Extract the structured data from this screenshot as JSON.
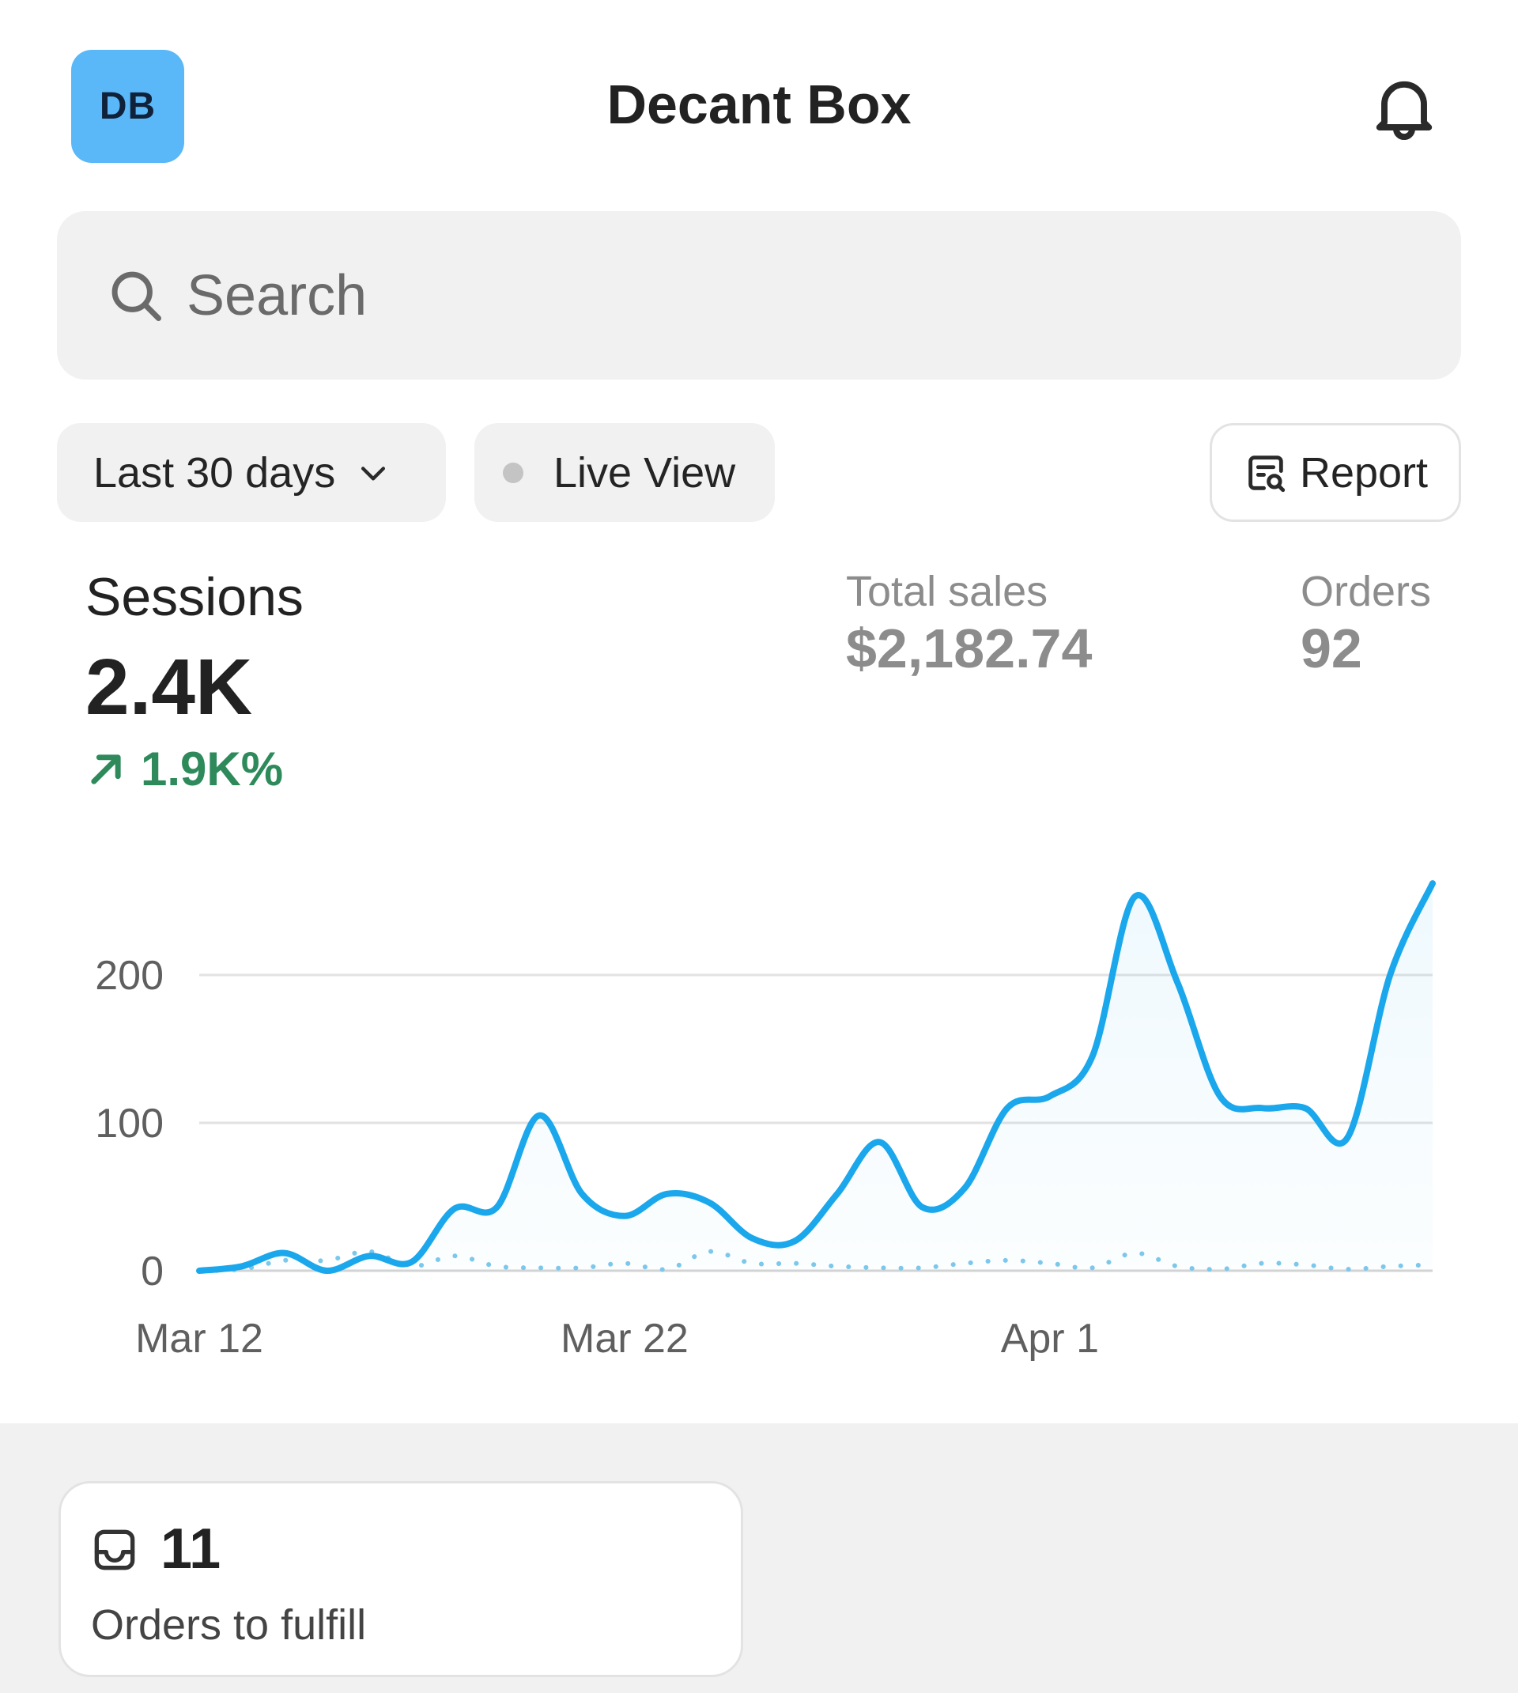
{
  "header": {
    "avatar_initials": "DB",
    "store_name": "Decant Box",
    "notification_icon": "bell-icon"
  },
  "search": {
    "placeholder": "Search",
    "icon": "search-icon"
  },
  "filters": {
    "date_range": "Last 30 days",
    "live_view": "Live View",
    "report": "Report"
  },
  "metrics": {
    "sessions": {
      "label": "Sessions",
      "value": "2.4K",
      "change": "1.9K%",
      "change_color": "#2e8a5b"
    },
    "total_sales": {
      "label": "Total sales",
      "value": "$2,182.74"
    },
    "orders": {
      "label": "Orders",
      "value": "92"
    }
  },
  "chart_data": {
    "type": "line",
    "y_ticks": [
      "200",
      "100",
      "0"
    ],
    "x_tick_labels": [
      "Mar 12",
      "Mar 22",
      "Apr 1"
    ],
    "ylim": [
      0,
      260
    ],
    "grid": true,
    "accent_color": "#1aa7ec",
    "series": [
      {
        "style": "solid",
        "x": [
          "Mar 12",
          "Mar 13",
          "Mar 14",
          "Mar 15",
          "Mar 16",
          "Mar 17",
          "Mar 18",
          "Mar 19",
          "Mar 20",
          "Mar 21",
          "Mar 22",
          "Mar 23",
          "Mar 24",
          "Mar 25",
          "Mar 26",
          "Mar 27",
          "Mar 28",
          "Mar 29",
          "Mar 30",
          "Mar 31",
          "Apr 1",
          "Apr 2",
          "Apr 3",
          "Apr 4",
          "Apr 5",
          "Apr 6",
          "Apr 7",
          "Apr 8",
          "Apr 9",
          "Apr 10"
        ],
        "values": [
          0,
          3,
          12,
          0,
          10,
          6,
          42,
          43,
          105,
          52,
          37,
          52,
          46,
          22,
          20,
          52,
          87,
          43,
          56,
          110,
          118,
          145,
          253,
          195,
          118,
          110,
          110,
          90,
          200,
          262
        ]
      },
      {
        "style": "dotted",
        "x": [
          "Mar 12",
          "Mar 13",
          "Mar 14",
          "Mar 15",
          "Mar 16",
          "Mar 17",
          "Mar 18",
          "Mar 19",
          "Mar 20",
          "Mar 21",
          "Mar 22",
          "Mar 23",
          "Mar 24",
          "Mar 25",
          "Mar 26",
          "Mar 27",
          "Mar 28",
          "Mar 29",
          "Mar 30",
          "Mar 31",
          "Apr 1",
          "Apr 2",
          "Apr 3",
          "Apr 4",
          "Apr 5",
          "Apr 6",
          "Apr 7",
          "Apr 8",
          "Apr 9",
          "Apr 10"
        ],
        "values": [
          0,
          1,
          7,
          7,
          13,
          3,
          10,
          3,
          2,
          2,
          5,
          1,
          13,
          5,
          5,
          3,
          2,
          2,
          5,
          7,
          5,
          2,
          12,
          3,
          1,
          5,
          4,
          1,
          3,
          4
        ]
      }
    ]
  },
  "fulfill_card": {
    "count": "11",
    "label": "Orders to fulfill",
    "icon": "inbox-icon"
  }
}
